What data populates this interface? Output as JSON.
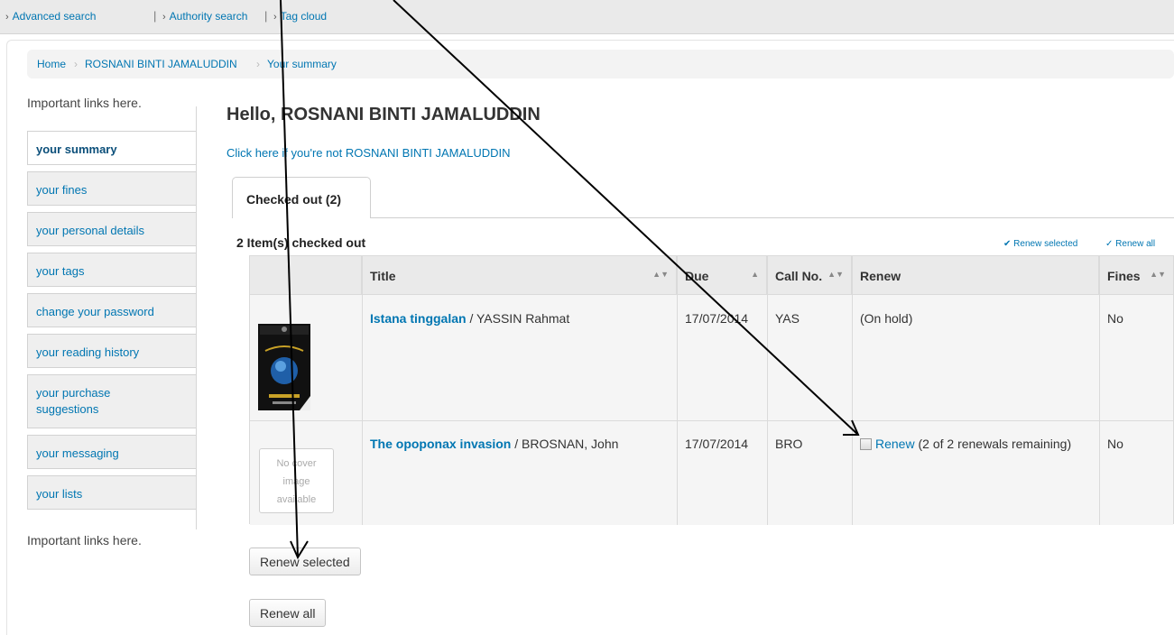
{
  "topbar": {
    "links": [
      "Advanced search",
      "Authority search",
      "Tag cloud"
    ]
  },
  "breadcrumb": [
    "Home",
    "ROSNANI BINTI JAMALUDDIN",
    "Your summary"
  ],
  "sidebar": {
    "important_top": "Important links here.",
    "important_bottom": "Important links here.",
    "items": [
      {
        "label": "your summary",
        "active": true
      },
      {
        "label": "your fines"
      },
      {
        "label": "your personal details"
      },
      {
        "label": "your tags"
      },
      {
        "label": "change your password"
      },
      {
        "label": "your reading history"
      },
      {
        "label": "your purchase suggestions"
      },
      {
        "label": "your messaging"
      },
      {
        "label": "your lists"
      }
    ]
  },
  "main": {
    "greeting": "Hello, ROSNANI BINTI JAMALUDDIN",
    "not_you": "Click here if you're not ROSNANI BINTI JAMALUDDIN",
    "tab_label": "Checked out (2)",
    "items_count": "2 Item(s) checked out",
    "renew_selected_link": "Renew selected",
    "renew_all_link": "Renew all"
  },
  "table": {
    "headers": [
      "Title",
      "Due",
      "Call No.",
      "Renew",
      "Fines"
    ],
    "rows": [
      {
        "title": "Istana tinggalan",
        "author": " / YASSIN Rahmat",
        "due": "17/07/2014",
        "callno": "YAS",
        "renew": "(On hold)",
        "fines": "No"
      },
      {
        "title": "The opoponax invasion",
        "author": " / BROSNAN, John",
        "due": "17/07/2014",
        "callno": "BRO",
        "renew_link": "Renew",
        "renew_note": " (2 of 2 renewals remaining)",
        "fines": "No",
        "cover_text": [
          "No cover",
          "image",
          "available"
        ]
      }
    ]
  },
  "buttons": {
    "renew_selected": "Renew selected",
    "renew_all": "Renew all"
  }
}
